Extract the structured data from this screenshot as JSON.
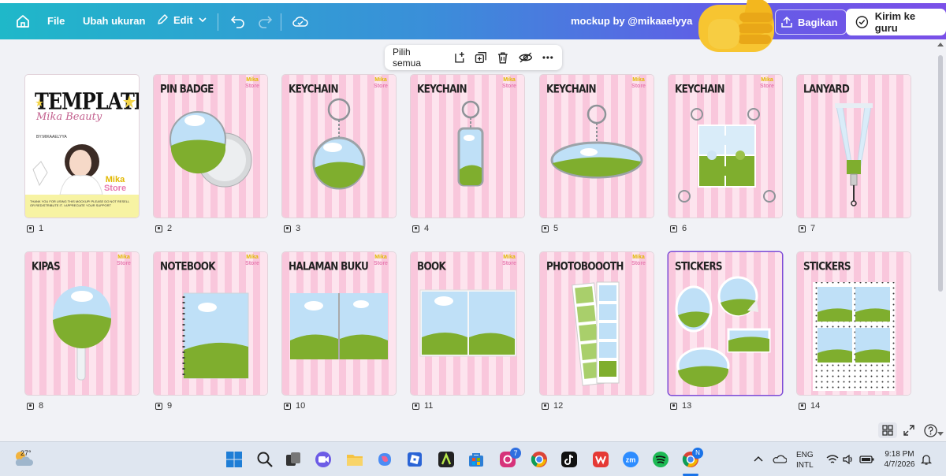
{
  "toolbar": {
    "file": "File",
    "resize": "Ubah ukuran",
    "edit": "Edit",
    "doc_title": "mockup by @mikaaelyya",
    "share": "Bagikan",
    "send": "Kirim ke guru"
  },
  "floatbar": {
    "select_all": "Pilih semua",
    "icons": [
      "add-page-icon",
      "duplicate-icon",
      "delete-icon",
      "hide-icon",
      "more-icon"
    ]
  },
  "pages": [
    {
      "num": "1",
      "title": ""
    },
    {
      "num": "2",
      "title": "PIN BADGE"
    },
    {
      "num": "3",
      "title": "KEYCHAIN"
    },
    {
      "num": "4",
      "title": "KEYCHAIN"
    },
    {
      "num": "5",
      "title": "KEYCHAIN"
    },
    {
      "num": "6",
      "title": "KEYCHAIN"
    },
    {
      "num": "7",
      "title": "LANYARD"
    },
    {
      "num": "8",
      "title": "KIPAS"
    },
    {
      "num": "9",
      "title": "NOTEBOOK"
    },
    {
      "num": "10",
      "title": "HALAMAN BUKU"
    },
    {
      "num": "11",
      "title": "BOOK"
    },
    {
      "num": "12",
      "title": "PHOTOBOOOTH"
    },
    {
      "num": "13",
      "title": "STICKERS"
    },
    {
      "num": "14",
      "title": "STICKERS"
    }
  ],
  "cover": {
    "template": "TEMPLATE",
    "script_name": "Mika Beauty",
    "by": "BY:MIKAAELYYA",
    "footer": "THANK YOU FOR USING THIS MOCKUP! PLEASE DO NOT RESELL OR REDISTRIBUTE IT. I APPRECIATE YOUR SUPPORT"
  },
  "logo": {
    "line1": "Mika",
    "line2": "Store"
  },
  "taskbar": {
    "weather": "27°",
    "lang1": "ENG",
    "lang2": "INTL",
    "time": "9:18 PM",
    "date": "4/7/2026",
    "badge_instagram": "7",
    "badge_chrome": "N"
  },
  "colors": {
    "accent": "#7d4bd6",
    "stripe_pink": "#f9c7dc",
    "sky": "#bfe0f7",
    "grass": "#7fae2e"
  }
}
